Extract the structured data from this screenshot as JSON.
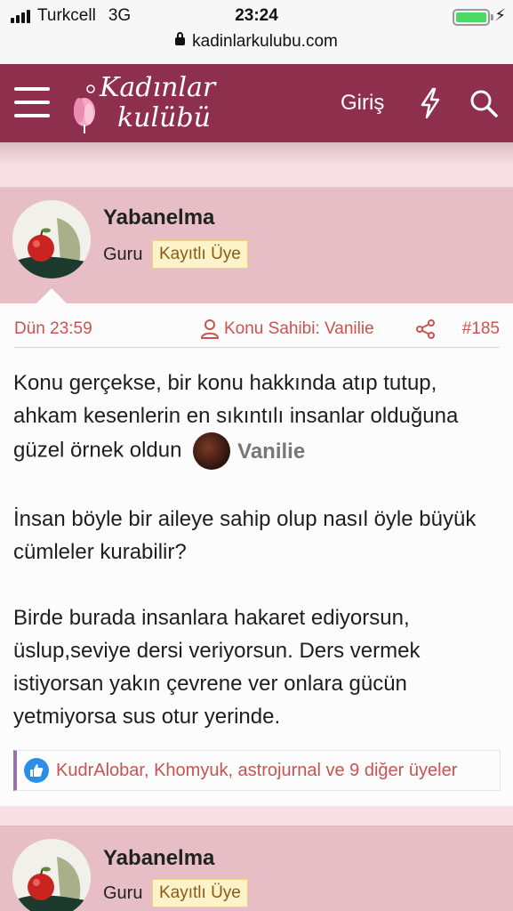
{
  "status_bar": {
    "carrier": "Turkcell",
    "network": "3G",
    "time": "23:24"
  },
  "url_bar": {
    "url": "kadinlarkulubu.com"
  },
  "header": {
    "logo_line1": "Kadınlar",
    "logo_line2": "kulübü",
    "login_label": "Giriş",
    "icons": [
      "menu-icon",
      "lightning-icon",
      "search-icon"
    ],
    "color": "#8e2f4e"
  },
  "post": {
    "username": "Yabanelma",
    "role": "Guru",
    "badge": "Kayıtlı Üye",
    "date": "Dün 23:59",
    "thread_owner": "Konu Sahibi: Vanilie",
    "post_number": "#185",
    "p1_text": "Konu gerçekse, bir konu hakkında atıp tutup, ahkam kesenlerin en sıkıntılı insanlar olduğuna güzel örnek oldun",
    "p1_mention": "Vanilie",
    "p2_text": "İnsan böyle bir aileye sahip olup nasıl öyle büyük cümleler kurabilir?",
    "p3_text": "Birde burada insanlara hakaret ediyorsun, üslup,seviye dersi veriyorsun. Ders vermek istiyorsan yakın çevrene ver onlara gücün yetmiyorsa sus otur yerinde.",
    "reactions": "KudrAlobar, Khomyuk, astrojurnal ve 9 diğer üyeler",
    "accent_color": "#c9534f"
  },
  "post2": {
    "username": "Yabanelma",
    "role": "Guru",
    "badge": "Kayıtlı Üye"
  }
}
